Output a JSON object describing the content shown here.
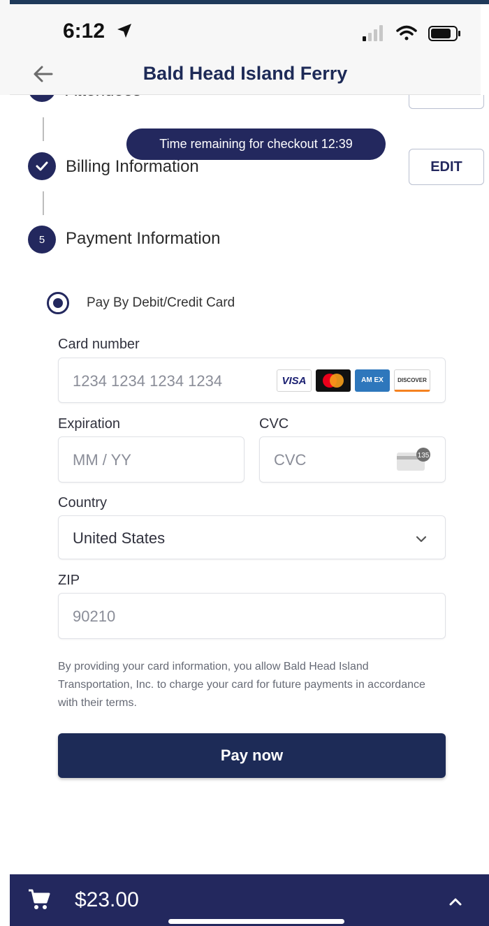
{
  "status_bar": {
    "time": "6:12"
  },
  "nav": {
    "title": "Bald Head Island Ferry"
  },
  "timer": {
    "text": "Time remaining for checkout 12:39"
  },
  "steps": [
    {
      "label": "Attendees",
      "state": "complete",
      "has_edit": true
    },
    {
      "label": "Billing Information",
      "state": "complete",
      "has_edit": true,
      "edit_label": "EDIT"
    },
    {
      "number": "5",
      "label": "Payment Information",
      "state": "active"
    }
  ],
  "payment": {
    "method_label": "Pay By Debit/Credit Card",
    "card_number_label": "Card number",
    "card_number_placeholder": "1234 1234 1234 1234",
    "card_brands": {
      "visa": "VISA",
      "amex": "AM EX",
      "discover": "DISCOVER"
    },
    "expiration_label": "Expiration",
    "expiration_placeholder": "MM / YY",
    "cvc_label": "CVC",
    "cvc_placeholder": "CVC",
    "cvc_icon_badge": "135",
    "country_label": "Country",
    "country_value": "United States",
    "zip_label": "ZIP",
    "zip_placeholder": "90210",
    "disclaimer": "By providing your card information, you allow Bald Head Island Transportation, Inc. to charge your card for future payments in accordance with their terms.",
    "pay_button": "Pay now"
  },
  "cart": {
    "total": "$23.00"
  },
  "colors": {
    "navy": "#23285e",
    "pay_button": "#1d2b57",
    "title": "#1d2a57"
  },
  "icons": [
    "location-arrow-icon",
    "signal-icon",
    "wifi-icon",
    "battery-icon",
    "back-arrow-icon",
    "checkmark-icon",
    "radio-selected-icon",
    "card-back-icon",
    "chevron-down-icon",
    "cart-icon",
    "chevron-up-icon"
  ]
}
